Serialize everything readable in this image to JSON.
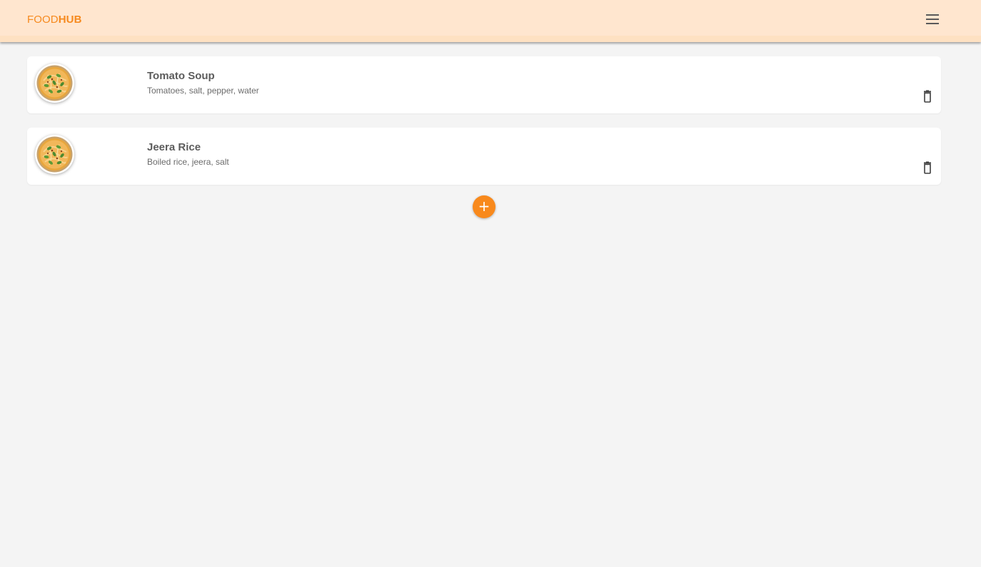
{
  "navbar": {
    "brand_part1": "FOOD",
    "brand_part2": "HUB",
    "menu_icon": "hamburger-menu-icon"
  },
  "items": [
    {
      "name": "Tomato Soup",
      "description": "Tomatoes, salt, pepper, water",
      "image_icon": "food-bowl-icon",
      "delete_icon": "trash-icon"
    },
    {
      "name": "Jeera Rice",
      "description": "Boiled rice, jeera, salt",
      "image_icon": "food-bowl-icon",
      "delete_icon": "trash-icon"
    }
  ],
  "add_button": {
    "label": "+",
    "icon": "plus-icon"
  },
  "colors": {
    "accent": "#f8891c",
    "navbar_bg": "#ffe6cf",
    "page_bg": "#f4f4f4",
    "card_bg": "#ffffff",
    "text_primary": "#5c5c5c"
  }
}
